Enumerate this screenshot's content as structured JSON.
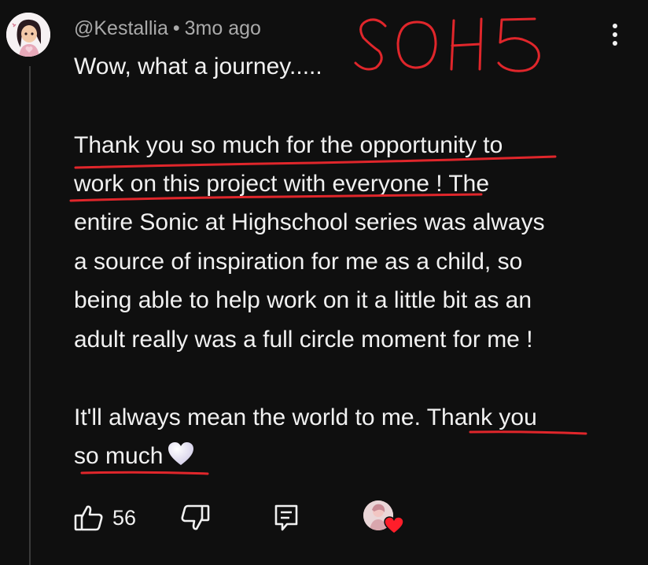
{
  "comment": {
    "author": "@Kestallia",
    "separator": "•",
    "time": "3mo ago",
    "lines": [
      "Wow, what a journey.....",
      "Thank you so much for the opportunity to",
      "work on this project with everyone ! The",
      "entire Sonic at Highschool series was always",
      "a source of inspiration for me as a child, so",
      "being able to help work on it a little bit as an",
      "adult really was a full circle moment for me !",
      "It'll always mean the world to me. Thank you",
      "so much"
    ]
  },
  "annotation": {
    "text": "SOH5",
    "color": "#e0262b"
  },
  "actions": {
    "like_count": "56",
    "icons": [
      "thumbs-up-icon",
      "thumbs-down-icon",
      "reply-icon",
      "creator-heart-avatar",
      "more-vert-icon"
    ]
  },
  "colors": {
    "background": "#0f0f0f",
    "text": "#f1f1f1",
    "secondary_text": "#aaaaaa",
    "annotation": "#e0262b"
  }
}
